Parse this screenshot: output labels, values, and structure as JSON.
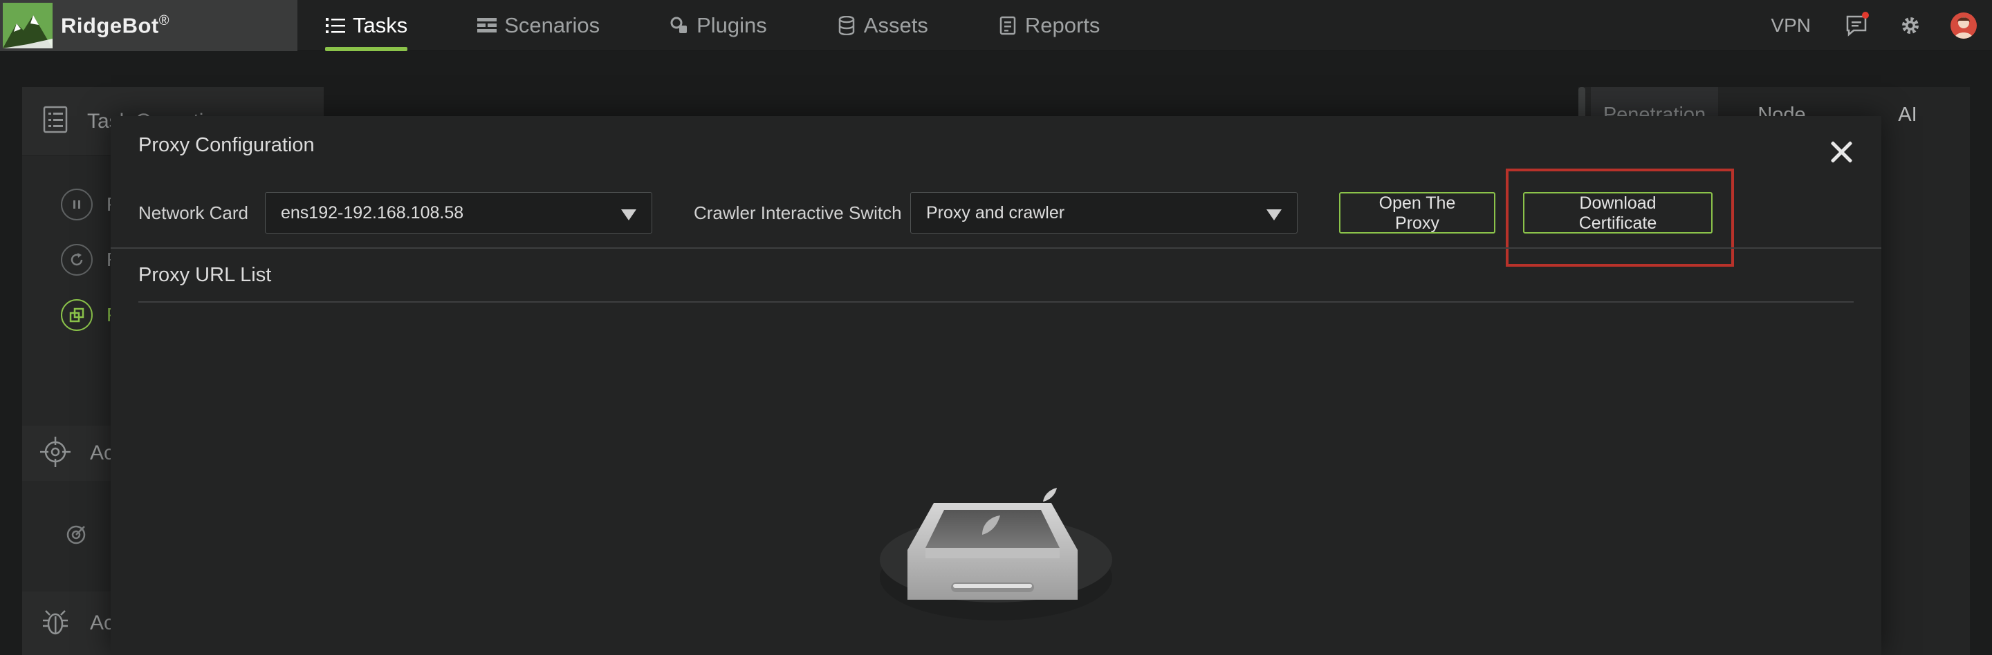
{
  "app": {
    "brand": "RidgeBot",
    "brand_mark": "®"
  },
  "nav": {
    "items": [
      {
        "label": "Tasks",
        "icon": "list-icon",
        "active": true
      },
      {
        "label": "Scenarios",
        "icon": "scenarios-icon",
        "active": false
      },
      {
        "label": "Plugins",
        "icon": "plugin-icon",
        "active": false
      },
      {
        "label": "Assets",
        "icon": "database-icon",
        "active": false
      },
      {
        "label": "Reports",
        "icon": "report-icon",
        "active": false
      }
    ]
  },
  "topright": {
    "vpn_label": "VPN",
    "icons": [
      "message-icon",
      "gear-icon",
      "avatar"
    ]
  },
  "background": {
    "left_panel": {
      "header_text": "Task Operations",
      "rows": [
        "P",
        "R",
        "P"
      ],
      "section_a": "Ac",
      "section_b": "Ac"
    },
    "right_tabs": [
      "Penetration",
      "Node",
      "AI"
    ]
  },
  "modal": {
    "title": "Proxy Configuration",
    "network_card_label": "Network Card",
    "network_card_value": "ens192-192.168.108.58",
    "crawler_label": "Crawler Interactive Switch",
    "crawler_value": "Proxy and crawler",
    "open_proxy_label": "Open The Proxy",
    "download_cert_label": "Download Certificate",
    "proxy_list_title": "Proxy URL List"
  },
  "colors": {
    "accent": "#8bc34a",
    "highlight": "#b8322a",
    "background": "#1b1c1c",
    "modal": "#232424"
  }
}
